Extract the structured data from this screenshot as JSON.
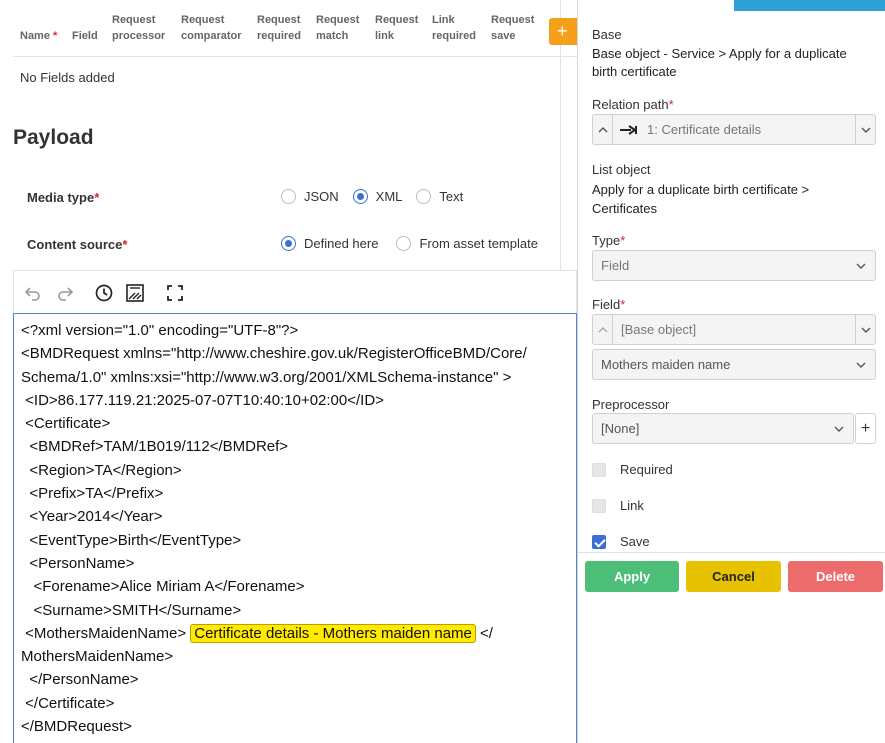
{
  "fields_table": {
    "headers": [
      {
        "line1": "Name",
        "required_mark": "*"
      },
      {
        "line1": "Field",
        "line2": ""
      },
      {
        "line1": "Request",
        "line2": "processor"
      },
      {
        "line1": "Request",
        "line2": "comparator"
      },
      {
        "line1": "Request",
        "line2": "required"
      },
      {
        "line1": "Request",
        "line2": "match"
      },
      {
        "line1": "Request",
        "line2": "link"
      },
      {
        "line1": "Link",
        "line2": "required"
      },
      {
        "line1": "Request",
        "line2": "save"
      }
    ],
    "add_label": "+",
    "empty_text": "No Fields added"
  },
  "payload": {
    "title": "Payload",
    "media_type": {
      "label": "Media type",
      "required_mark": "*",
      "options": [
        {
          "label": "JSON",
          "selected": false
        },
        {
          "label": "XML",
          "selected": true
        },
        {
          "label": "Text",
          "selected": false
        }
      ]
    },
    "content_source": {
      "label": "Content source",
      "required_mark": "*",
      "options": [
        {
          "label": "Defined here",
          "selected": true
        },
        {
          "label": "From asset template",
          "selected": false
        }
      ]
    }
  },
  "editor": {
    "toolbar_icons": [
      "undo-icon",
      "redo-icon",
      "history-icon",
      "format-icon",
      "fullscreen-icon"
    ],
    "lines": [
      "<?xml version=\"1.0\" encoding=\"UTF-8\"?>",
      "<BMDRequest xmlns=\"http://www.cheshire.gov.uk/RegisterOfficeBMD/Core/",
      "Schema/1.0\" xmlns:xsi=\"http://www.w3.org/2001/XMLSchema-instance\" >",
      " <ID>86.177.119.21:2025-07-07T10:40:10+02:00</ID>",
      " <Certificate>",
      "  <BMDRef>TAM/1B019/112</BMDRef>",
      "  <Region>TA</Region>",
      "  <Prefix>TA</Prefix>",
      "  <Year>2014</Year>",
      "  <EventType>Birth</EventType>",
      "  <PersonName>",
      "   <Forename>Alice Miriam A</Forename>",
      "   <Surname>SMITH</Surname>"
    ],
    "maiden_open": " <MothersMaidenName> ",
    "maiden_token": "Certificate details - Mothers maiden name",
    "maiden_close": " </",
    "lines_after": [
      "MothersMaidenName>",
      "  </PersonName>",
      " </Certificate>",
      "</BMDRequest>"
    ]
  },
  "side_panel": {
    "base_label": "Base",
    "base_value": "Base object - Service > Apply for a duplicate birth certificate",
    "relation_path": {
      "label": "Relation path",
      "required_mark": "*",
      "value": "1: Certificate details"
    },
    "list_object_label": "List object",
    "list_object_value": "Apply for a duplicate birth certificate > Certificates",
    "type": {
      "label": "Type",
      "required_mark": "*",
      "value": "Field"
    },
    "field": {
      "label": "Field",
      "required_mark": "*",
      "value": "[Base object]",
      "sub_value": "Mothers maiden name"
    },
    "preprocessor": {
      "label": "Preprocessor",
      "value": "[None]",
      "add_label": "+"
    },
    "checkboxes": [
      {
        "label": "Required",
        "checked": false
      },
      {
        "label": "Link",
        "checked": false
      },
      {
        "label": "Save",
        "checked": true
      }
    ],
    "buttons": {
      "apply": "Apply",
      "cancel": "Cancel",
      "delete": "Delete"
    }
  }
}
